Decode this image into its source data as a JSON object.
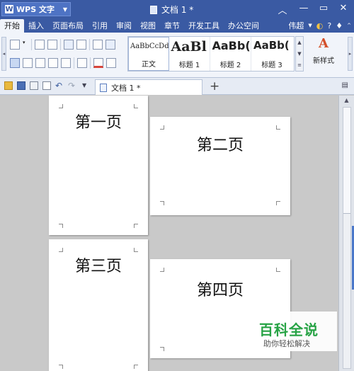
{
  "app": {
    "name": "WPS 文字",
    "document_title": "文档 1 *"
  },
  "menu": {
    "tabs": [
      "开始",
      "插入",
      "页面布局",
      "引用",
      "审阅",
      "视图",
      "章节",
      "开发工具",
      "办公空间"
    ],
    "active_tab": "开始",
    "user": "伟超"
  },
  "ribbon": {
    "styles": [
      {
        "sample": "AaBbCcDd",
        "name": "正文"
      },
      {
        "sample": "AaBl",
        "name": "标题 1"
      },
      {
        "sample": "AaBb(",
        "name": "标题 2"
      },
      {
        "sample": "AaBb(",
        "name": "标题 3"
      }
    ],
    "new_style_icon_text": "A",
    "new_style_label": "新样式"
  },
  "tabbar": {
    "doc_tab_label": "文档 1 *",
    "add_tab_symbol": "+"
  },
  "pages": [
    {
      "heading": "第一页"
    },
    {
      "heading": "第二页"
    },
    {
      "heading": "第三页"
    },
    {
      "heading": "第四页"
    }
  ],
  "watermark": {
    "title": "百科全说",
    "subtitle": "助你轻松解决"
  },
  "colors": {
    "title_bar": "#3a5aa3",
    "ribbon_bg": "#f1f4fa",
    "workspace_bg": "#c9c9c9",
    "watermark_green": "#27a345"
  }
}
